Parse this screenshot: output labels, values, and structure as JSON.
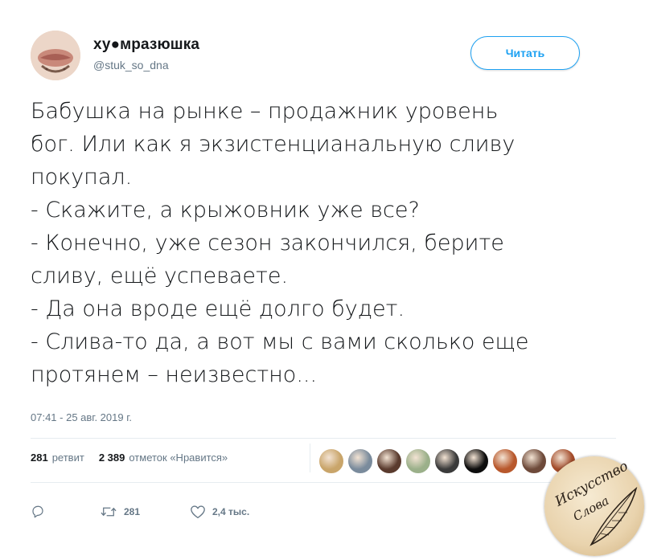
{
  "author": {
    "display_name": "ху●мразюшка",
    "handle": "@stuk_so_dna"
  },
  "follow_button": {
    "label": "Читать"
  },
  "tweet": {
    "lines": [
      "Бабушка на рынке – продажник уровень",
      "бог. Или как я экзистенцианальную сливу",
      "покупал.",
      "- Скажите, а крыжовник уже все?",
      "- Конечно, уже сезон закончился, берите",
      "сливу, ещё успеваете.",
      "- Да она вроде ещё долго будет.",
      "- Слива-то да, а вот мы с вами сколько еще",
      "протянем – неизвестно..."
    ],
    "timestamp": "07:41 - 25 авг. 2019 г."
  },
  "stats": {
    "retweets_count": "281",
    "retweets_label": "ретвит",
    "likes_count": "2 389",
    "likes_label": "отметок «Нравится»"
  },
  "likers": [
    {
      "icon": "avatar-1",
      "color": "#c9a56a"
    },
    {
      "icon": "avatar-2",
      "color": "#7a8b9c"
    },
    {
      "icon": "avatar-3",
      "color": "#5a3b2e"
    },
    {
      "icon": "avatar-4",
      "color": "#9bb08a"
    },
    {
      "icon": "avatar-5",
      "color": "#3a3a3a"
    },
    {
      "icon": "avatar-6",
      "color": "#0d0d0d"
    },
    {
      "icon": "avatar-7",
      "color": "#b8582c"
    },
    {
      "icon": "avatar-8",
      "color": "#6e4a3a"
    },
    {
      "icon": "avatar-9",
      "color": "#a34b2a"
    }
  ],
  "actions": {
    "reply": {
      "icon": "reply-icon",
      "count": ""
    },
    "retweet": {
      "icon": "retweet-icon",
      "count": "281"
    },
    "like": {
      "icon": "heart-icon",
      "count": "2,4 тыс."
    }
  },
  "watermark": {
    "line1": "Искусство",
    "line2": "Слова",
    "icon": "quill-feather-icon"
  },
  "colors": {
    "accent": "#1da1f2",
    "text": "#14171a",
    "secondary": "#657786"
  }
}
